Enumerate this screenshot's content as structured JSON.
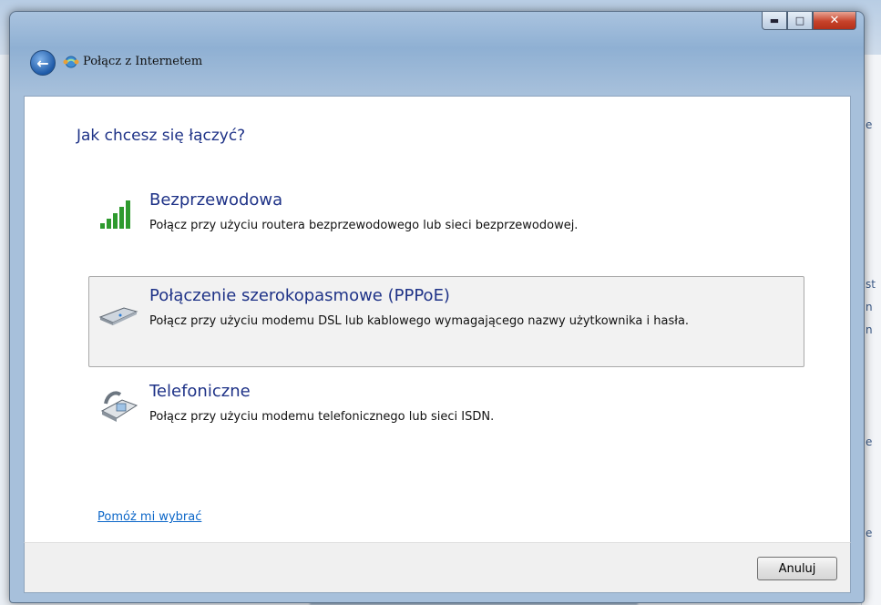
{
  "window": {
    "title": "Połącz z Internetem",
    "controls": [
      "minimize",
      "maximize",
      "close"
    ]
  },
  "content": {
    "heading": "Jak chcesz się łączyć?",
    "options": [
      {
        "title": "Bezprzewodowa",
        "description": "Połącz przy użyciu routera bezprzewodowego lub sieci bezprzewodowej.",
        "icon": "wireless-signal-icon",
        "selected": false
      },
      {
        "title": "Połączenie szerokopasmowe (PPPoE)",
        "description": "Połącz przy użyciu modemu DSL lub kablowego wymagającego nazwy użytkownika i hasła.",
        "icon": "broadband-modem-icon",
        "selected": true
      },
      {
        "title": "Telefoniczne",
        "description": "Połącz przy użyciu modemu telefonicznego lub sieci ISDN.",
        "icon": "dialup-phone-icon",
        "selected": false
      }
    ],
    "help_link": "Pomóż mi wybrać"
  },
  "footer": {
    "cancel_label": "Anuluj"
  }
}
